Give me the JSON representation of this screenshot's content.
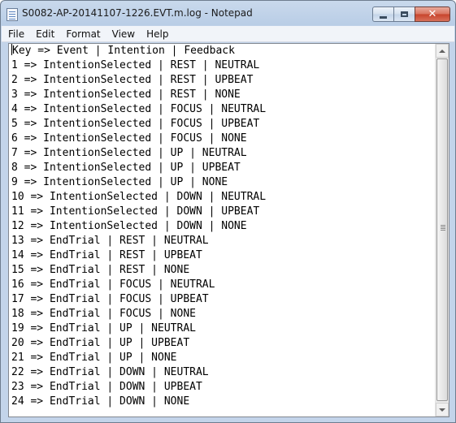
{
  "window": {
    "title": "S0082-AP-20141107-1226.EVT.m.log - Notepad",
    "controls": {
      "close_glyph": "✕"
    }
  },
  "menu": [
    "File",
    "Edit",
    "Format",
    "View",
    "Help"
  ],
  "editor": {
    "lines": [
      "Key => Event | Intention | Feedback",
      "1 => IntentionSelected | REST | NEUTRAL",
      "2 => IntentionSelected | REST | UPBEAT",
      "3 => IntentionSelected | REST | NONE",
      "4 => IntentionSelected | FOCUS | NEUTRAL",
      "5 => IntentionSelected | FOCUS | UPBEAT",
      "6 => IntentionSelected | FOCUS | NONE",
      "7 => IntentionSelected | UP | NEUTRAL",
      "8 => IntentionSelected | UP | UPBEAT",
      "9 => IntentionSelected | UP | NONE",
      "10 => IntentionSelected | DOWN | NEUTRAL",
      "11 => IntentionSelected | DOWN | UPBEAT",
      "12 => IntentionSelected | DOWN | NONE",
      "13 => EndTrial | REST | NEUTRAL",
      "14 => EndTrial | REST | UPBEAT",
      "15 => EndTrial | REST | NONE",
      "16 => EndTrial | FOCUS | NEUTRAL",
      "17 => EndTrial | FOCUS | UPBEAT",
      "18 => EndTrial | FOCUS | NONE",
      "19 => EndTrial | UP | NEUTRAL",
      "20 => EndTrial | UP | UPBEAT",
      "21 => EndTrial | UP | NONE",
      "22 => EndTrial | DOWN | NEUTRAL",
      "23 => EndTrial | DOWN | UPBEAT",
      "24 => EndTrial | DOWN | NONE"
    ]
  }
}
